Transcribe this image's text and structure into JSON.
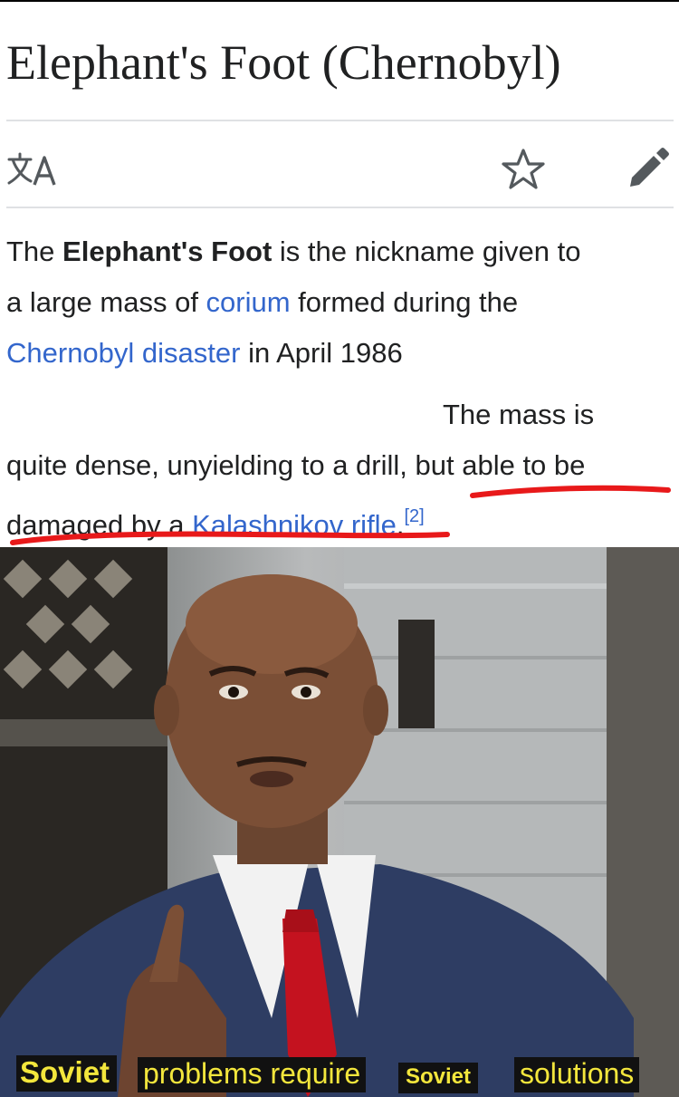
{
  "article": {
    "title": "Elephant's Foot (Chernobyl)",
    "icons": [
      "translate-icon",
      "star-icon",
      "edit-icon"
    ],
    "line1_pre": "The ",
    "line1_bold": "Elephant's Foot",
    "line1_post": " is the nickname given to",
    "line2_pre": "a large mass of ",
    "line2_link": "corium",
    "line2_post": " formed during the",
    "line3_link": "Chernobyl disaster",
    "line3_post": " in April 1986",
    "line4": "The mass is",
    "line5": "quite dense, unyielding to a drill, but able to be",
    "line6_pre": "damaged by a ",
    "line6_link": "Kalashnikov rifle",
    "line6_post": ".",
    "citation": "[2]",
    "link_color": "#3366cc",
    "underline_color": "#e8191a"
  },
  "meme": {
    "caption_1": "Soviet",
    "caption_2": "problems require",
    "caption_3": "Soviet",
    "caption_4": "solutions",
    "caption_color": "#f3e63c"
  }
}
